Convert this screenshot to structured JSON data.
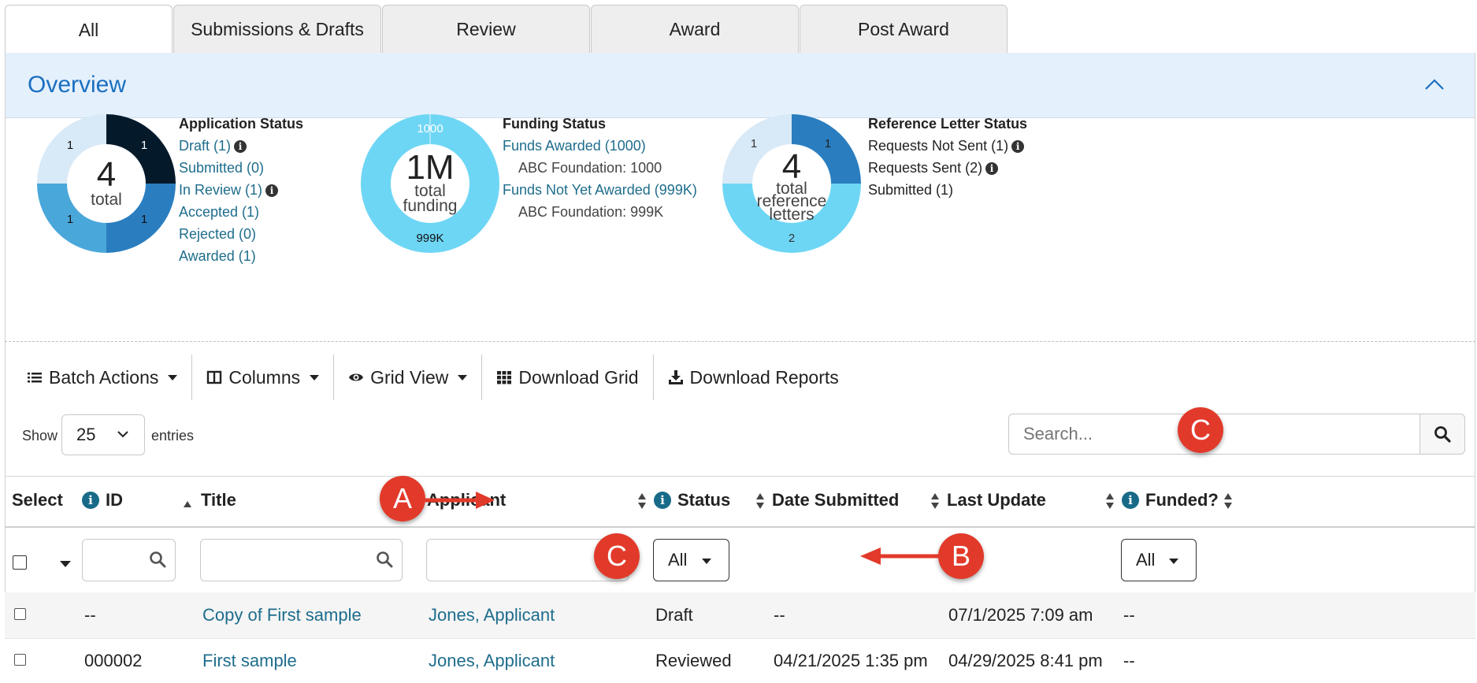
{
  "tabs": [
    "All",
    "Submissions & Drafts",
    "Review",
    "Award",
    "Post Award"
  ],
  "overview": {
    "title": "Overview",
    "application": {
      "center_number": "4",
      "center_label": "total",
      "slice_labels": [
        "1",
        "1",
        "1",
        "1"
      ],
      "heading": "Application Status",
      "items": [
        "Draft (1)",
        "Submitted (0)",
        "In Review (1)",
        "Accepted (1)",
        "Rejected (0)",
        "Awarded (1)"
      ]
    },
    "funding": {
      "center_number": "1M",
      "center_label_1": "total",
      "center_label_2": "funding",
      "top_label": "1000",
      "bottom_label": "999K",
      "heading": "Funding Status",
      "awarded": "Funds Awarded (1000)",
      "awarded_sub": "ABC Foundation: 1000",
      "not_awarded": "Funds Not Yet Awarded (999K)",
      "not_awarded_sub": "ABC Foundation: 999K"
    },
    "reference": {
      "center_number": "4",
      "center_label_1": "total",
      "center_label_2": "reference",
      "center_label_3": "letters",
      "slice_left": "1",
      "slice_right": "1",
      "slice_bottom": "2",
      "heading": "Reference Letter Status",
      "items": [
        "Requests Not Sent (1)",
        "Requests Sent (2)",
        "Submitted (1)"
      ]
    },
    "colors": {
      "navy": "#04192a",
      "dark_blue": "#2a7ec0",
      "mid_blue": "#4aa7da",
      "light_blue": "#d8e9f7",
      "cyan": "#6ed6f5"
    }
  },
  "toolbar": {
    "batch": "Batch Actions",
    "columns": "Columns",
    "grid_view": "Grid View",
    "download_grid": "Download Grid",
    "download_reports": "Download Reports"
  },
  "entries": {
    "show": "Show",
    "value": "25",
    "label": "entries"
  },
  "search": {
    "placeholder": "Search..."
  },
  "table": {
    "headers": {
      "select": "Select",
      "id": "ID",
      "title": "Title",
      "applicant": "Applicant",
      "status": "Status",
      "date_submitted": "Date Submitted",
      "last_update": "Last Update",
      "funded": "Funded?"
    },
    "filters": {
      "status": "All",
      "funded": "All"
    },
    "rows": [
      {
        "id": "--",
        "title": "Copy of First sample",
        "applicant": "Jones, Applicant",
        "status": "Draft",
        "date_submitted": "--",
        "last_update": "07/1/2025 7:09 am",
        "funded": "--"
      },
      {
        "id": "000002",
        "title": "First sample",
        "applicant": "Jones, Applicant",
        "status": "Reviewed",
        "date_submitted": "04/21/2025 1:35 pm",
        "last_update": "04/29/2025 8:41 pm",
        "funded": "--"
      }
    ]
  },
  "annotations": {
    "a": "A",
    "b": "B",
    "c": "C"
  }
}
